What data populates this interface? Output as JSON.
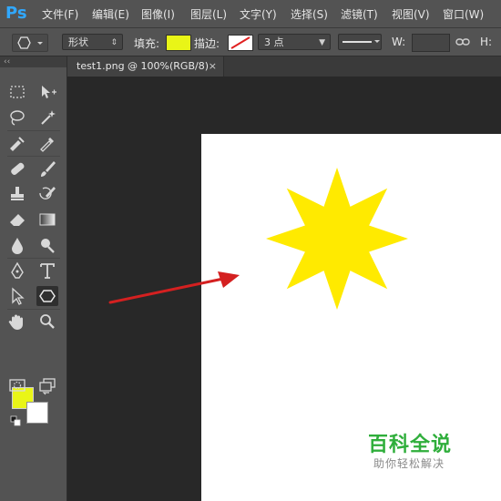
{
  "app": {
    "logo": "Ps"
  },
  "menu": [
    "文件(F)",
    "编辑(E)",
    "图像(I)",
    "图层(L)",
    "文字(Y)",
    "选择(S)",
    "滤镜(T)",
    "视图(V)",
    "窗口(W)"
  ],
  "options": {
    "shape_mode": "形状",
    "fill_label": "填充:",
    "fill_color": "#e9f517",
    "stroke_label": "描边:",
    "stroke_color": "#ffffff",
    "stroke_size": "3 点",
    "w_label": "W:",
    "h_label": "H:"
  },
  "document": {
    "tab_title": "test1.png @ 100%(RGB/8)",
    "close_glyph": "×"
  },
  "toolbar": {
    "grip": "‹‹",
    "foreground_color": "#e9f517",
    "background_color": "#ffffff"
  },
  "canvas": {
    "background": "#ffffff",
    "star_color": "#ffea00",
    "star_points": 8,
    "arrow_color": "#d42020"
  },
  "watermark": {
    "title": "百科全说",
    "subtitle": "助你轻松解决"
  }
}
